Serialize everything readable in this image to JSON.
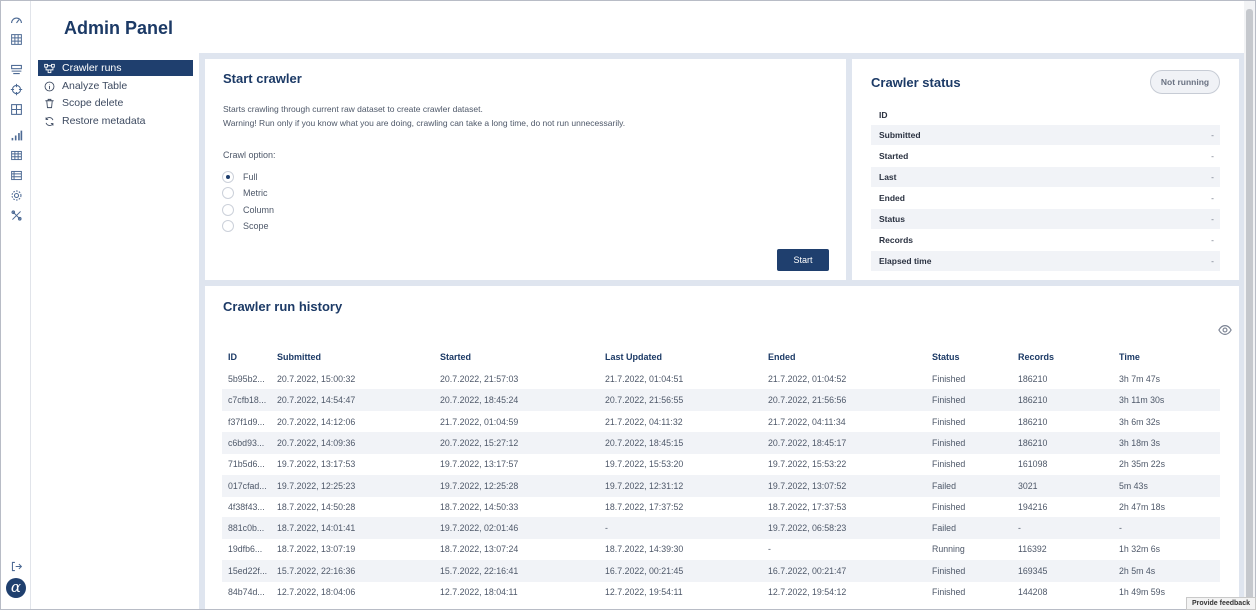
{
  "header": {
    "title": "Admin Panel"
  },
  "rail": {
    "icons": [
      "dashboard-icon",
      "database-icon",
      "layers-icon",
      "target-icon",
      "grid-icon",
      "bar-chart-icon",
      "table-icon",
      "list-table-icon",
      "gear-icon",
      "tools-icon"
    ],
    "logout_icon": "logout-icon",
    "logo": "α"
  },
  "subnav": {
    "items": [
      {
        "label": "Crawler runs",
        "icon": "crawler-icon",
        "active": true
      },
      {
        "label": "Analyze Table",
        "icon": "info-icon",
        "active": false
      },
      {
        "label": "Scope delete",
        "icon": "trash-icon",
        "active": false
      },
      {
        "label": "Restore metadata",
        "icon": "refresh-icon",
        "active": false
      }
    ]
  },
  "start_crawler": {
    "title": "Start crawler",
    "description_1": "Starts crawling through current raw dataset to create crawler dataset.",
    "description_2": "Warning! Run only if you know what you are doing, crawling can take a long time, do not run unnecessarily.",
    "crawl_option_label": "Crawl option:",
    "options": [
      "Full",
      "Metric",
      "Column",
      "Scope"
    ],
    "selected_option": "Full",
    "start_label": "Start"
  },
  "crawler_status": {
    "title": "Crawler status",
    "badge": "Not running",
    "rows": [
      {
        "key": "ID",
        "value": ""
      },
      {
        "key": "Submitted",
        "value": "-"
      },
      {
        "key": "Started",
        "value": "-"
      },
      {
        "key": "Last",
        "value": "-"
      },
      {
        "key": "Ended",
        "value": "-"
      },
      {
        "key": "Status",
        "value": "-"
      },
      {
        "key": "Records",
        "value": "-"
      },
      {
        "key": "Elapsed time",
        "value": "-"
      }
    ]
  },
  "history": {
    "title": "Crawler run history",
    "columns": [
      "ID",
      "Submitted",
      "Started",
      "Last Updated",
      "Ended",
      "Status",
      "Records",
      "Time"
    ],
    "rows": [
      [
        "5b95b2...",
        "20.7.2022, 15:00:32",
        "20.7.2022, 21:57:03",
        "21.7.2022, 01:04:51",
        "21.7.2022, 01:04:52",
        "Finished",
        "186210",
        "3h 7m 47s"
      ],
      [
        "c7cfb18...",
        "20.7.2022, 14:54:47",
        "20.7.2022, 18:45:24",
        "20.7.2022, 21:56:55",
        "20.7.2022, 21:56:56",
        "Finished",
        "186210",
        "3h 11m 30s"
      ],
      [
        "f37f1d9...",
        "20.7.2022, 14:12:06",
        "21.7.2022, 01:04:59",
        "21.7.2022, 04:11:32",
        "21.7.2022, 04:11:34",
        "Finished",
        "186210",
        "3h 6m 32s"
      ],
      [
        "c6bd93...",
        "20.7.2022, 14:09:36",
        "20.7.2022, 15:27:12",
        "20.7.2022, 18:45:15",
        "20.7.2022, 18:45:17",
        "Finished",
        "186210",
        "3h 18m 3s"
      ],
      [
        "71b5d6...",
        "19.7.2022, 13:17:53",
        "19.7.2022, 13:17:57",
        "19.7.2022, 15:53:20",
        "19.7.2022, 15:53:22",
        "Finished",
        "161098",
        "2h 35m 22s"
      ],
      [
        "017cfad...",
        "19.7.2022, 12:25:23",
        "19.7.2022, 12:25:28",
        "19.7.2022, 12:31:12",
        "19.7.2022, 13:07:52",
        "Failed",
        "3021",
        "5m 43s"
      ],
      [
        "4f38f43...",
        "18.7.2022, 14:50:28",
        "18.7.2022, 14:50:33",
        "18.7.2022, 17:37:52",
        "18.7.2022, 17:37:53",
        "Finished",
        "194216",
        "2h 47m 18s"
      ],
      [
        "881c0b...",
        "18.7.2022, 14:01:41",
        "19.7.2022, 02:01:46",
        "-",
        "19.7.2022, 06:58:23",
        "Failed",
        "-",
        "-"
      ],
      [
        "19dfb6...",
        "18.7.2022, 13:07:19",
        "18.7.2022, 13:07:24",
        "18.7.2022, 14:39:30",
        "-",
        "Running",
        "116392",
        "1h 32m 6s"
      ],
      [
        "15ed22f...",
        "15.7.2022, 22:16:36",
        "15.7.2022, 22:16:41",
        "16.7.2022, 00:21:45",
        "16.7.2022, 00:21:47",
        "Finished",
        "169345",
        "2h 5m 4s"
      ],
      [
        "84b74d...",
        "12.7.2022, 18:04:06",
        "12.7.2022, 18:04:11",
        "12.7.2022, 19:54:11",
        "12.7.2022, 19:54:12",
        "Finished",
        "144208",
        "1h 49m 59s"
      ]
    ]
  },
  "feedback_label": "Provide feedback",
  "colors": {
    "brand": "#1f3f6e",
    "background": "#dfe5ef",
    "row_alt": "#f1f3f7"
  }
}
